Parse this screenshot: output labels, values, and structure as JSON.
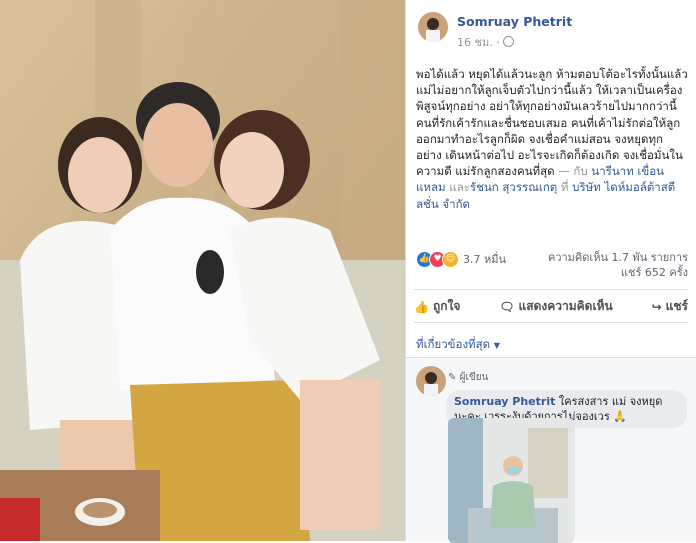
{
  "post": {
    "author": "Somruay Phetrit",
    "time": "16 ชม.",
    "text_main": "พอได้แล้ว หยุดได้แล้วนะลูก ห้ามตอบโต้อะไรทั้งนั้นแล้ว แม่ไม่อยากให้ลูกเจ็บตัวไปกว่านี้แล้ว ให้เวลาเป็นเครื่องพิสูจน์ทุกอย่าง อย่าให้ทุกอย่างมันเลวร้ายไปมากกว่านี้ คนที่รักเค้ารักและชื่นชอบเสมอ คนที่เค้าไม่รักต่อให้ลูกออกมาทำอะไรลูกก็ผิด จงเชื่อคำแม่สอน จงหยุดทุกอย่าง เดินหน้าต่อไป อะไรจะเกิดก็ต้องเกิด จงเชื่อมั่นในความดี แม่รักลูกสองคนที่สุด",
    "with_label": "— กับ",
    "tag1": "นารีนาท เขื่อนแหลม",
    "and_label": "และ",
    "tag2": "รัชนก สุวรรณเกตุ",
    "at_label": "ที่",
    "place": "บริษัท ไดห์มอล์ต้าสตีลชั่น จำกัด",
    "reaction_count": "3.7 หมื่น",
    "comments_stat": "ความคิดเห็น 1.7 พัน รายการ",
    "shares_stat": "แชร์ 652 ครั้ง"
  },
  "actions": {
    "like": "ถูกใจ",
    "comment": "แสดงความคิดเห็น",
    "share": "แชร์"
  },
  "filter_label": "ที่เกี่ยวข้องที่สุด",
  "comment": {
    "badge": "ผู้เขียน",
    "author": "Somruay Phetrit",
    "text": "ใครสงสาร แม่ จงหยุด นะคะ เวรระงับด้วยการไม่จองเวร"
  },
  "colors": {
    "link": "#365899",
    "like_blue": "#1877f2",
    "love_red": "#f33e58",
    "haha_yellow": "#f7b125"
  }
}
